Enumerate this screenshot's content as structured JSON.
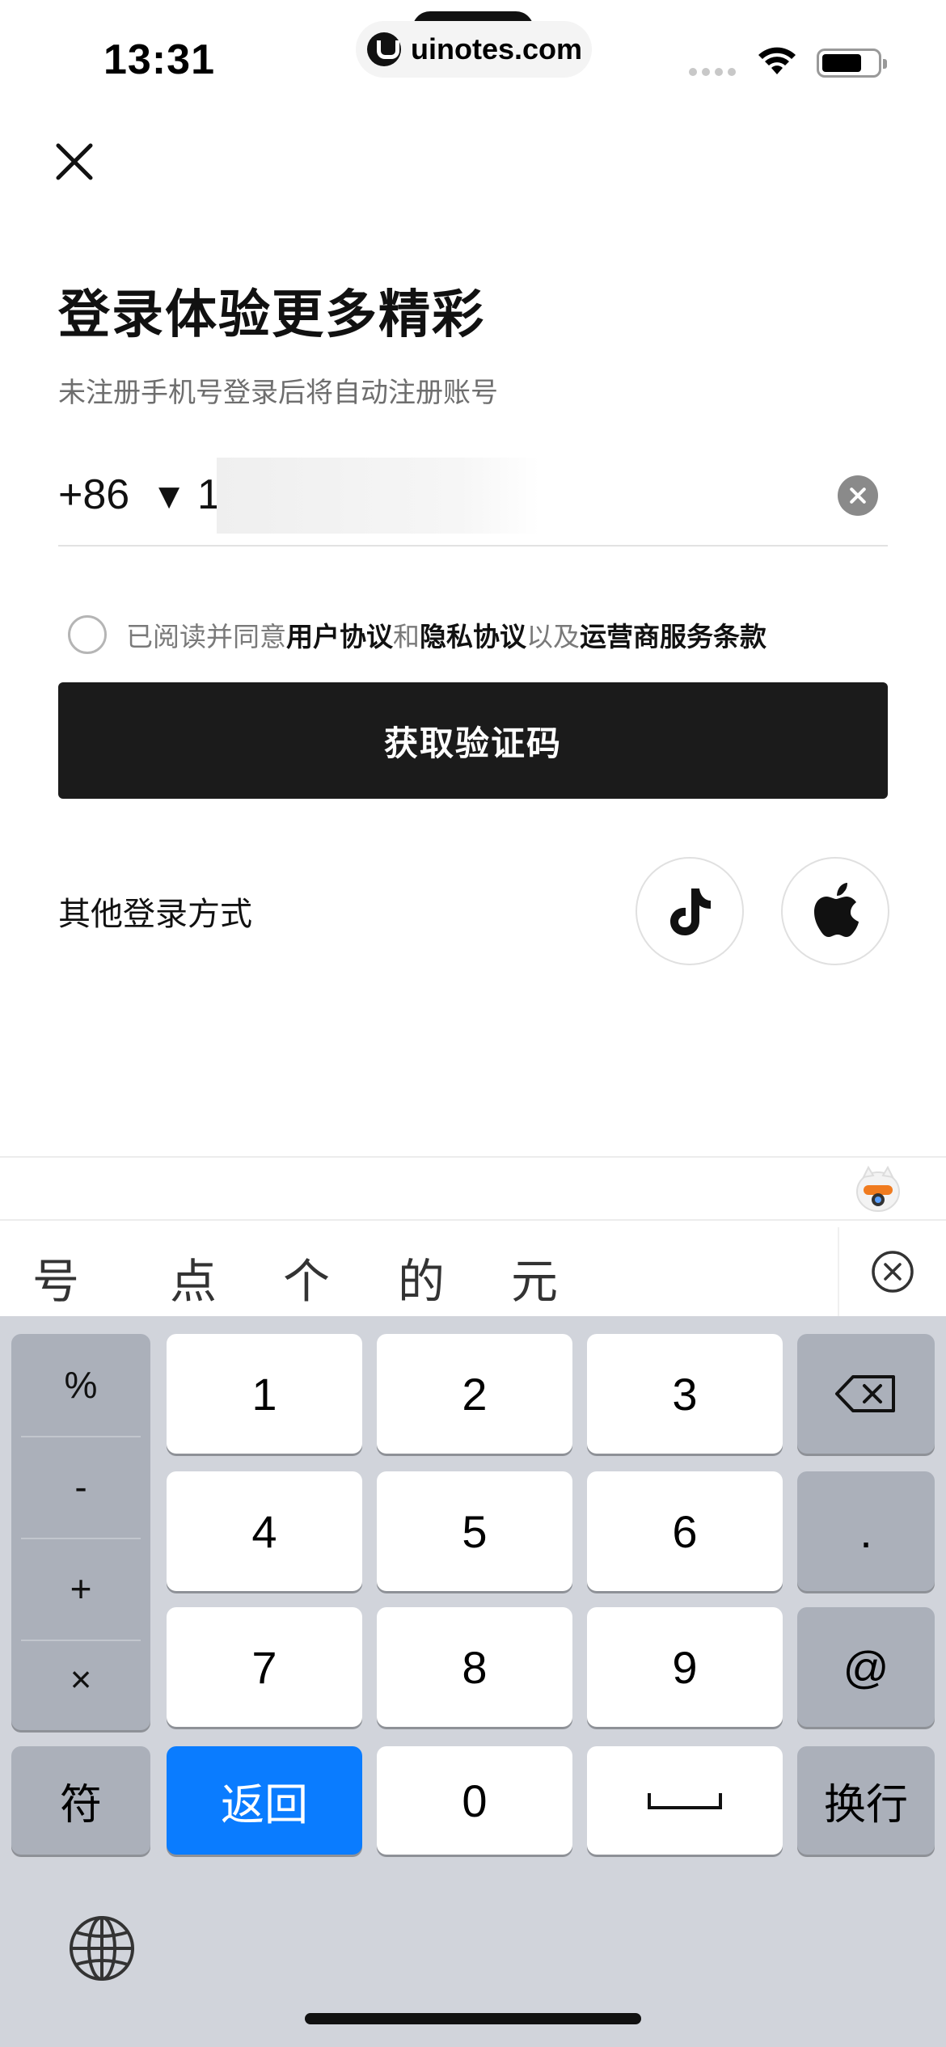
{
  "status_bar": {
    "time": "13:31",
    "url": "uinotes.com",
    "icons": [
      "cellular-dots-icon",
      "wifi-icon",
      "battery-icon"
    ]
  },
  "login": {
    "close_icon": "close-icon",
    "title": "登录体验更多精彩",
    "subtitle": "未注册手机号登录后将自动注册账号",
    "phone": {
      "country_code": "+86",
      "arrow": "▼",
      "value": "1"
    },
    "agreement": {
      "prefix": "已阅读并同意",
      "user_agreement": "用户协议",
      "and": "和",
      "privacy_agreement": "隐私协议",
      "also": "以及",
      "carrier_terms": "运营商服务条款"
    },
    "get_code_button": "获取验证码",
    "other_methods_label": "其他登录方式",
    "social_icons": [
      "tiktok-icon",
      "apple-icon"
    ]
  },
  "keyboard": {
    "candidates": [
      "号",
      "点",
      "个",
      "的",
      "元"
    ],
    "symbols": [
      "%",
      "-",
      "+",
      "×"
    ],
    "digits": [
      "1",
      "2",
      "3",
      "4",
      "5",
      "6",
      "7",
      "8",
      "9",
      "0"
    ],
    "dot": ".",
    "at": "@",
    "fu": "符",
    "return_label": "返回",
    "newline_label": "换行",
    "space_symbol": "␣"
  },
  "colors": {
    "primary_button": "#1b1b1b",
    "keyboard_bg": "#d1d4db",
    "return_key": "#0a7cff"
  }
}
